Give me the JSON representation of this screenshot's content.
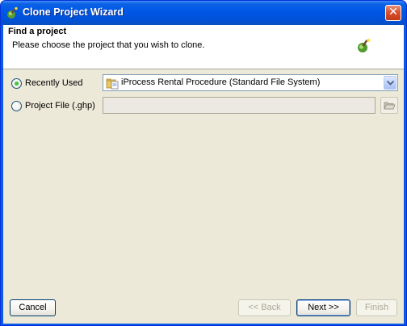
{
  "window": {
    "title": "Clone Project Wizard",
    "close_glyph": "✕",
    "icon": "wizard-icon"
  },
  "header": {
    "title": "Find a project",
    "subtitle": "Please choose the project that you wish to clone.",
    "icon": "wizard-icon"
  },
  "options": {
    "recently_used": {
      "label": "Recently Used",
      "selected": true
    },
    "project_file": {
      "label": "Project File (.ghp)",
      "selected": false
    }
  },
  "combo": {
    "value": "iProcess Rental Procedure (Standard File System)",
    "icon": "project-folder-icon"
  },
  "file_field": {
    "value": ""
  },
  "buttons": {
    "cancel": "Cancel",
    "back": "<< Back",
    "next": "Next >>",
    "finish": "Finish"
  },
  "colors": {
    "titlebar": "#0058e6",
    "dialog_bg": "#ece9d8",
    "header_bg": "#ffffff"
  }
}
